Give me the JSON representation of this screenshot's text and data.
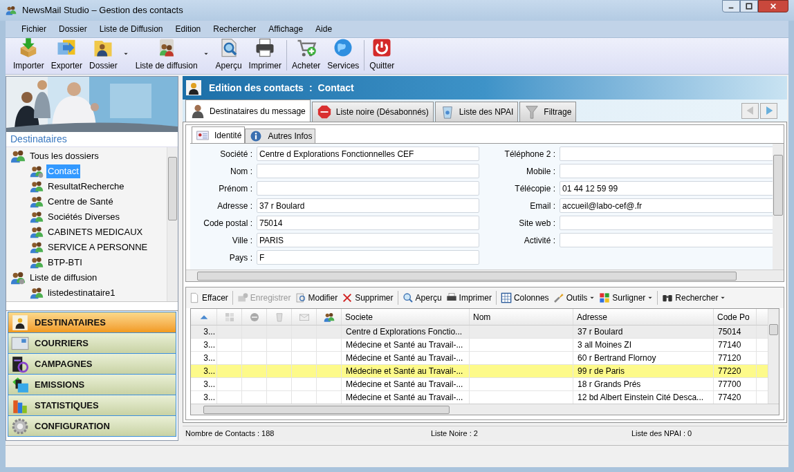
{
  "window": {
    "title": "NewsMail Studio – Gestion des contacts"
  },
  "menu": [
    "Fichier",
    "Dossier",
    "Liste de Diffusion",
    "Edition",
    "Rechercher",
    "Affichage",
    "Aide"
  ],
  "toolbar": [
    {
      "label": "Importer",
      "dropdown": false
    },
    {
      "label": "Exporter",
      "dropdown": false
    },
    {
      "label": "Dossier",
      "dropdown": true
    },
    {
      "label": "Liste de diffusion",
      "dropdown": true
    },
    {
      "label": "Aperçu",
      "dropdown": false
    },
    {
      "label": "Imprimer",
      "dropdown": false
    },
    {
      "label": "Acheter",
      "dropdown": false
    },
    {
      "label": "Services",
      "dropdown": false
    },
    {
      "label": "Quitter",
      "dropdown": false
    }
  ],
  "sidebar": {
    "title": "Destinataires",
    "tree": [
      {
        "label": "Tous les dossiers",
        "selected": false,
        "children": [
          {
            "label": "Contact",
            "selected": true
          },
          {
            "label": "ResultatRecherche",
            "selected": false
          },
          {
            "label": "Centre de Santé",
            "selected": false
          },
          {
            "label": "Sociétés Diverses",
            "selected": false
          },
          {
            "label": "CABINETS MEDICAUX",
            "selected": false
          },
          {
            "label": "SERVICE A PERSONNE",
            "selected": false
          },
          {
            "label": "BTP-BTI",
            "selected": false
          }
        ]
      },
      {
        "label": "Liste de diffusion",
        "selected": false,
        "children": [
          {
            "label": "listedestinataire1",
            "selected": false
          }
        ]
      }
    ],
    "nav": [
      {
        "label": "DESTINATAIRES",
        "selected": true
      },
      {
        "label": "COURRIERS",
        "selected": false
      },
      {
        "label": "CAMPAGNES",
        "selected": false
      },
      {
        "label": "EMISSIONS",
        "selected": false
      },
      {
        "label": "STATISTIQUES",
        "selected": false
      },
      {
        "label": "CONFIGURATION",
        "selected": false
      }
    ]
  },
  "header": {
    "title": "Edition des contacts",
    "separator": ":",
    "subtitle": "Contact"
  },
  "tabs": [
    {
      "label": "Destinataires du message",
      "selected": true
    },
    {
      "label": "Liste noire (Désabonnés)",
      "selected": false
    },
    {
      "label": "Liste des NPAI",
      "selected": false
    },
    {
      "label": "Filtrage",
      "selected": false
    }
  ],
  "subtabs": [
    {
      "label": "Identité",
      "selected": true
    },
    {
      "label": "Autres Infos",
      "selected": false
    }
  ],
  "form_left": [
    {
      "label": "Société :",
      "value": "Centre d Explorations Fonctionnelles CEF"
    },
    {
      "label": "Nom :"
    },
    {
      "label": "Prénom :"
    },
    {
      "label": "Adresse :",
      "value": "37 r Boulard"
    },
    {
      "label": "Code postal :",
      "value": "75014"
    },
    {
      "label": "Ville :",
      "value": "PARIS"
    },
    {
      "label": "Pays :",
      "value": "F"
    }
  ],
  "form_right": [
    {
      "label": "Téléphone 2 :"
    },
    {
      "label": "Mobile :"
    },
    {
      "label": "Télécopie :",
      "value": "01 44 12 59 99"
    },
    {
      "label": "Email :",
      "value": "accueil@labo-cef@.fr"
    },
    {
      "label": "Site web :"
    },
    {
      "label": "Activité :"
    }
  ],
  "grid_toolbar": [
    {
      "label": "Effacer",
      "disabled": false,
      "dropdown": false
    },
    {
      "label": "Enregistrer",
      "disabled": true,
      "dropdown": false
    },
    {
      "label": "Modifier",
      "disabled": false,
      "dropdown": false
    },
    {
      "label": "Supprimer",
      "disabled": false,
      "dropdown": false
    },
    {
      "label": "Aperçu",
      "disabled": false,
      "dropdown": false
    },
    {
      "label": "Imprimer",
      "disabled": false,
      "dropdown": false
    },
    {
      "label": "Colonnes",
      "disabled": false,
      "dropdown": false
    },
    {
      "label": "Outils",
      "disabled": false,
      "dropdown": true
    },
    {
      "label": "Surligner",
      "disabled": false,
      "dropdown": true
    },
    {
      "label": "Rechercher",
      "disabled": false,
      "dropdown": true
    }
  ],
  "table": {
    "columns": [
      "Societe",
      "Nom",
      "Adresse",
      "Code Po"
    ],
    "rows": [
      {
        "id": "3...",
        "societe": "Centre d Explorations Fonctio...",
        "nom": "",
        "adresse": "37 r Boulard",
        "code": "75014",
        "current": true,
        "selected": false
      },
      {
        "id": "3...",
        "societe": "Médecine et Santé au Travail-...",
        "nom": "",
        "adresse": "3 all Moines ZI",
        "code": "77140",
        "current": false,
        "selected": false
      },
      {
        "id": "3...",
        "societe": "Médecine et Santé au Travail-...",
        "nom": "",
        "adresse": "60 r Bertrand Flornoy",
        "code": "77120",
        "current": false,
        "selected": false
      },
      {
        "id": "3...",
        "societe": "Médecine et Santé au Travail-...",
        "nom": "",
        "adresse": "99 r de Paris",
        "code": "77220",
        "current": false,
        "selected": true
      },
      {
        "id": "3...",
        "societe": "Médecine et Santé au Travail-...",
        "nom": "",
        "adresse": "18 r Grands Prés",
        "code": "77700",
        "current": false,
        "selected": false
      },
      {
        "id": "3...",
        "societe": "Médecine et Santé au Travail-...",
        "nom": "",
        "adresse": "12 bd Albert Einstein Cité Desca...",
        "code": "77420",
        "current": false,
        "selected": false
      }
    ]
  },
  "status": [
    "Nombre de Contacts : 188",
    "Liste Noire : 2",
    "Liste des NPAI : 0"
  ]
}
